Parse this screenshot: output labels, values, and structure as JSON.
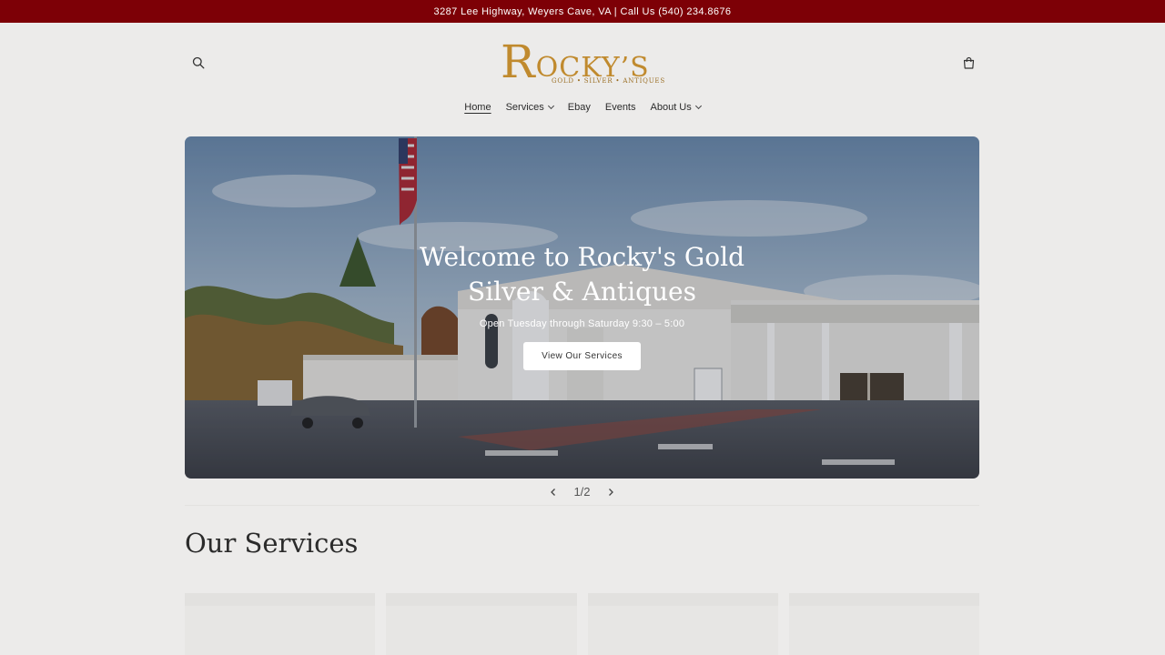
{
  "announcement": {
    "text": "3287 Lee Highway, Weyers Cave, VA | Call Us (540) 234.8676"
  },
  "header": {
    "logo": {
      "text": "ROCKY'S",
      "tagline": "GOLD • SILVER • ANTIQUES"
    },
    "search_icon": "search-icon",
    "cart_icon": "cart-icon"
  },
  "nav": {
    "items": [
      {
        "label": "Home"
      },
      {
        "label": "Services"
      },
      {
        "label": "Ebay"
      },
      {
        "label": "Events"
      },
      {
        "label": "About Us"
      }
    ]
  },
  "hero": {
    "title": "Welcome to Rocky's Gold Silver & Antiques",
    "subtitle": "Open Tuesday through Saturday 9:30 – 5:00",
    "button": "View Our Services"
  },
  "slider": {
    "counter": "1/2"
  },
  "services": {
    "title": "Our Services"
  },
  "colors": {
    "announcement_bg": "#7d0006",
    "logo_gold": "#c08a2e"
  }
}
